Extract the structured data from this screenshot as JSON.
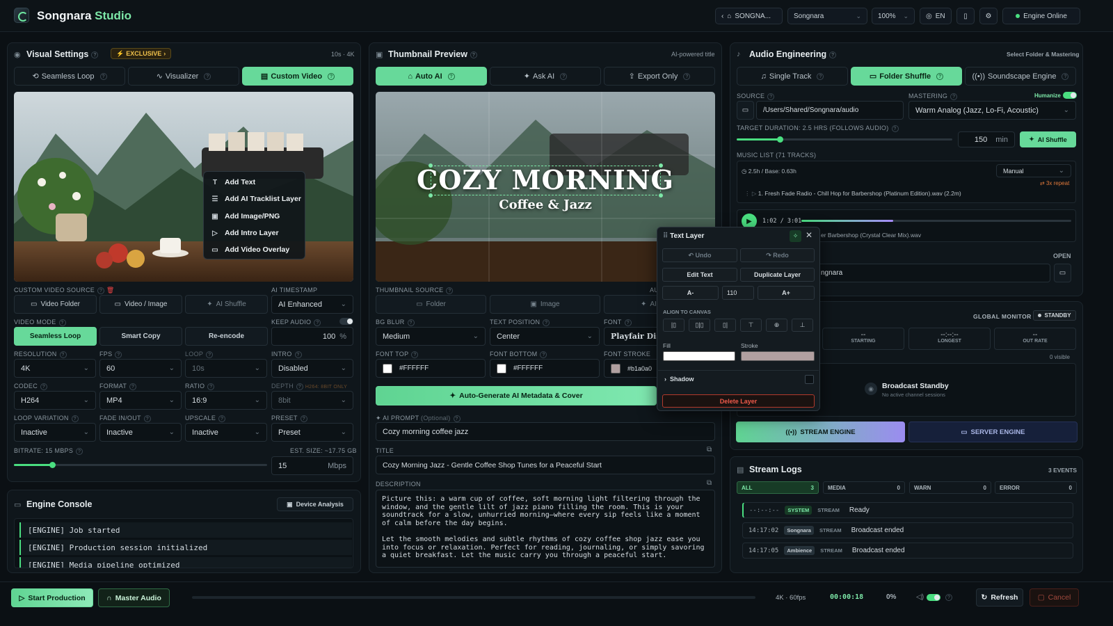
{
  "app": {
    "brand_1": "Songnara",
    "brand_2": "Studio"
  },
  "topbar": {
    "breadcrumb": "SONGNA...",
    "workspace": "Songnara",
    "zoom": "100%",
    "lang": "EN",
    "engine_status": "Engine Online"
  },
  "visual": {
    "title": "Visual Settings",
    "badge": "EXCLUSIVE",
    "meta": "10s · 4K",
    "tabs": [
      "Seamless Loop",
      "Visualizer",
      "Custom Video"
    ],
    "context_menu": [
      "Add Text",
      "Add AI Tracklist Layer",
      "Add Image/PNG",
      "Add Intro Layer",
      "Add Video Overlay"
    ],
    "source_label": "CUSTOM VIDEO SOURCE",
    "source_buttons": [
      "Video Folder",
      "Video / Image",
      "AI Shuffle"
    ],
    "ai_timestamp_label": "AI TIMESTAMP",
    "ai_timestamp": "AI Enhanced",
    "video_mode_label": "VIDEO MODE",
    "video_modes": [
      "Seamless Loop",
      "Smart Copy",
      "Re-encode"
    ],
    "keep_audio_label": "KEEP AUDIO",
    "keep_audio_value": "100",
    "keep_audio_unit": "%",
    "resolution_label": "RESOLUTION",
    "resolution": "4K",
    "fps_label": "FPS",
    "fps": "60",
    "loop_label": "LOOP",
    "loop": "10s",
    "intro_label": "INTRO",
    "intro": "Disabled",
    "codec_label": "CODEC",
    "codec": "H264",
    "format_label": "FORMAT",
    "format": "MP4",
    "ratio_label": "RATIO",
    "ratio": "16:9",
    "depth_label": "DEPTH",
    "depth_note": "H264: 8BIT ONLY",
    "depth": "8bit",
    "loop_variation_label": "LOOP VARIATION",
    "loop_variation": "Inactive",
    "fade_label": "FADE IN/OUT",
    "fade": "Inactive",
    "upscale_label": "UPSCALE",
    "upscale": "Inactive",
    "preset_label": "PRESET",
    "preset": "Preset",
    "bitrate_label": "BITRATE: 15 MBPS",
    "est_size": "EST. SIZE: ~17.75 GB",
    "bitrate_value": "15",
    "bitrate_unit": "Mbps",
    "bitrate_fraction": 0.15
  },
  "console": {
    "title": "Engine Console",
    "device_button": "Device Analysis",
    "lines": [
      "[ENGINE] Job started",
      "[ENGINE] Production session initialized",
      "[ENGINE] Media pipeline optimized"
    ]
  },
  "thumb": {
    "title": "Thumbnail Preview",
    "meta": "AI-powered title",
    "tabs": [
      "Auto AI",
      "Ask AI",
      "Export Only"
    ],
    "headline": "COZY MORNING",
    "subhead": "Coffee & Jazz",
    "source_label": "THUMBNAIL SOURCE",
    "source_buttons": [
      "Folder",
      "Image",
      "AI"
    ],
    "source_extra": "AU",
    "bg_blur_label": "BG BLUR",
    "bg_blur": "Medium",
    "text_pos_label": "TEXT POSITION",
    "text_pos": "Center",
    "font_label": "FONT",
    "font": "Playfair Displ",
    "font_top_label": "FONT TOP",
    "font_top": "#FFFFFF",
    "font_bottom_label": "FONT BOTTOM",
    "font_bottom": "#FFFFFF",
    "font_stroke_label": "FONT STROKE",
    "font_stroke": "#b1a0a0",
    "generate_button": "Auto-Generate AI Metadata & Cover",
    "prompt_label": "AI PROMPT",
    "prompt_optional": "(Optional)",
    "prompt": "Cozy morning coffee jazz",
    "title_label": "TITLE",
    "title_value": "Cozy Morning Jazz - Gentle Coffee Shop Tunes for a Peaceful Start",
    "desc_label": "DESCRIPTION",
    "description": "Picture this: a warm cup of coffee, soft morning light filtering through the window, and the gentle lilt of jazz piano filling the room. This is your soundtrack for a slow, unhurried morning—where every sip feels like a moment of calm before the day begins.\n\nLet the smooth melodies and subtle rhythms of cozy coffee shop jazz ease you into focus or relaxation. Perfect for reading, journaling, or simply savoring a quiet breakfast. Let the music carry you through a peaceful start."
  },
  "text_layer": {
    "title": "Text Layer",
    "undo": "Undo",
    "redo": "Redo",
    "edit": "Edit Text",
    "duplicate": "Duplicate Layer",
    "minus": "A-",
    "size": "110",
    "plus": "A+",
    "align_label": "ALIGN TO CANVAS",
    "fill_label": "Fill",
    "stroke_label": "Stroke",
    "shadow_label": "Shadow",
    "delete": "Delete Layer",
    "fill_color": "#FFFFFF",
    "stroke_color": "#b1a0a0"
  },
  "audio": {
    "title": "Audio Engineering",
    "meta": "Select Folder & Mastering",
    "tabs": [
      "Single Track",
      "Folder Shuffle",
      "Soundscape Engine"
    ],
    "source_label": "SOURCE",
    "source_path": "/Users/Shared/Songnara/audio",
    "mastering_label": "MASTERING",
    "humanize": "Humanize",
    "mastering": "Warm Analog (Jazz, Lo-Fi, Acoustic)",
    "target_label": "TARGET DURATION: 2.5 HRS (FOLLOWS AUDIO)",
    "target_value": "150",
    "target_unit": "min",
    "ai_shuffle": "AI Shuffle",
    "target_fraction": 0.2,
    "music_list_label": "MUSIC LIST (71 TRACKS)",
    "music_list_meta": "2.5h / Base: 0.63h",
    "order": "Manual",
    "repeat": "3x repeat",
    "track1": "1. Fresh Fade Radio - Chill Hop for Barbershop (Platinum Edition).wav (2.2m)",
    "player_time": "1:02 / 3:01",
    "player_progress": 0.34,
    "track2": "er Barbershop (Crystal Clear Mix).wav",
    "open_label": "OPEN",
    "channel": "ngnara"
  },
  "stream": {
    "global_monitor": "GLOBAL MONITOR",
    "standby": "STANDBY",
    "stats": [
      {
        "value": "--",
        "label": "STARTING"
      },
      {
        "value": "--:--:--",
        "label": "LONGEST"
      },
      {
        "value": "--",
        "label": "OUT RATE"
      }
    ],
    "visible": "0 visible",
    "broadcast_title": "Broadcast Standby",
    "broadcast_sub": "No active channel sessions",
    "stream_engine": "STREAM ENGINE",
    "server_engine": "SERVER ENGINE"
  },
  "logs": {
    "title": "Stream Logs",
    "count": "3 EVENTS",
    "filters": [
      {
        "label": "ALL",
        "n": "3"
      },
      {
        "label": "MEDIA",
        "n": "0"
      },
      {
        "label": "WARN",
        "n": "0"
      },
      {
        "label": "ERROR",
        "n": "0"
      }
    ],
    "rows": [
      {
        "time": "--:--:--",
        "tag": "SYSTEM",
        "kind": "STREAM",
        "msg": "Ready"
      },
      {
        "time": "14:17:02",
        "tag": "Songnara",
        "kind": "STREAM",
        "msg": "Broadcast ended"
      },
      {
        "time": "14:17:05",
        "tag": "Ambience",
        "kind": "STREAM",
        "msg": "Broadcast ended"
      }
    ]
  },
  "bottom": {
    "start": "Start Production",
    "master": "Master Audio",
    "spec": "4K · 60fps",
    "timer": "00:00:18",
    "percent": "0%",
    "refresh": "Refresh",
    "cancel": "Cancel"
  },
  "colors": {
    "accent": "#67d99a",
    "panel": "#0f161b",
    "danger": "#ef4444"
  }
}
